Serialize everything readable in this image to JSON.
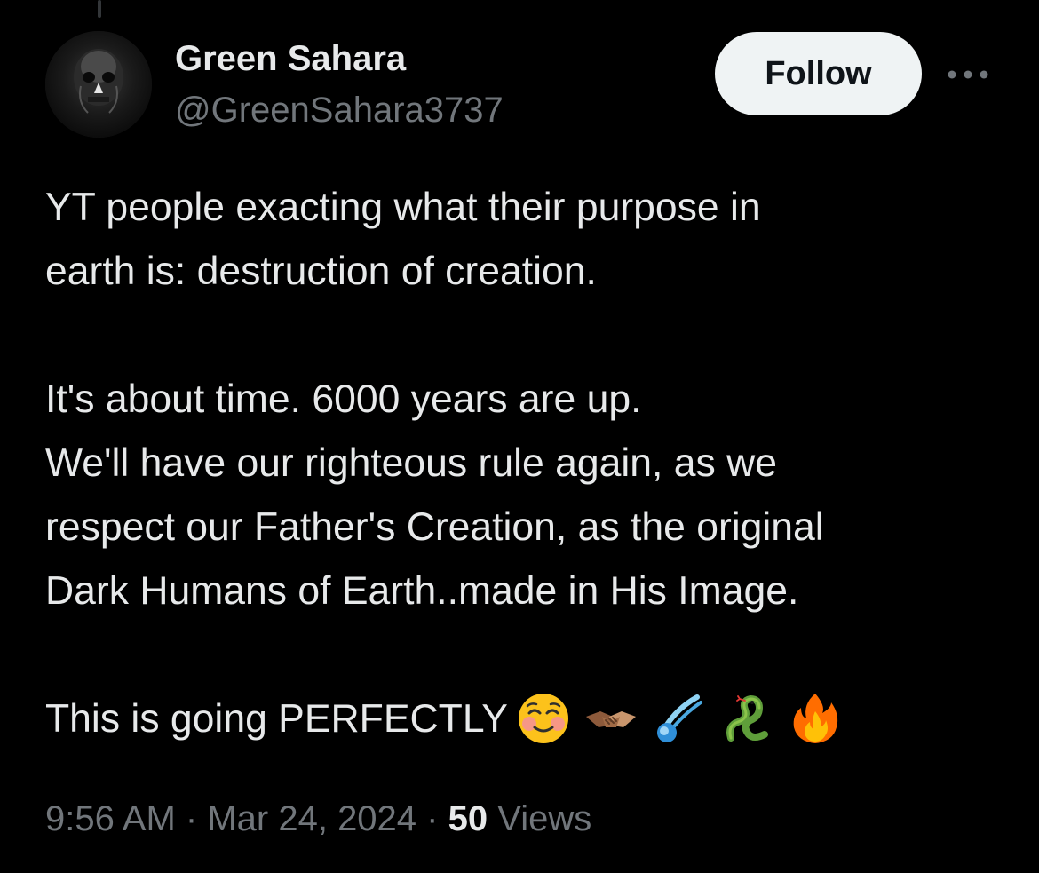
{
  "author": {
    "display_name": "Green Sahara",
    "handle": "@GreenSahara3737"
  },
  "actions": {
    "follow_label": "Follow",
    "more_icon": "more-horizontal-icon"
  },
  "tweet": {
    "lines": [
      "YT people exacting what their purpose in",
      "earth is: destruction of creation.",
      "It's about time. 6000 years are up.",
      "We'll have our righteous rule again, as we",
      "respect our Father's Creation, as the original",
      "Dark Humans of Earth..made in His Image.",
      "This is going PERFECTLY"
    ],
    "emojis": [
      "smiling-face-icon",
      "handshake-icon",
      "comet-icon",
      "snake-icon",
      "fire-icon"
    ]
  },
  "meta": {
    "time": "9:56 AM",
    "separator": "·",
    "date": "Mar 24, 2024",
    "views_count": "50",
    "views_label": "Views"
  },
  "colors": {
    "background": "#000000",
    "primary_text": "#e7e9ea",
    "secondary_text": "#71767b",
    "follow_button_bg": "#eff3f4",
    "follow_button_text": "#0f1419"
  }
}
